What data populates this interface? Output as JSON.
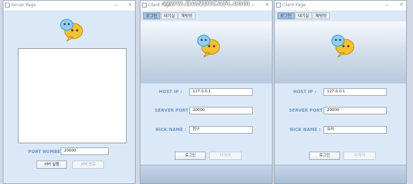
{
  "watermark": "www.BANDICAM.com",
  "server": {
    "title": "Server Page",
    "window_controls": [
      "—",
      "✕"
    ],
    "port_label": "PORT NUMBER :",
    "port_value": "20000",
    "start_button": "서버 실행",
    "stop_button": "서버 종료"
  },
  "client1": {
    "title": "Client Page",
    "window_controls": [
      "—",
      "✕"
    ],
    "tabs": [
      "로그인",
      "대기실",
      "채팅방"
    ],
    "host_label": "HOST IP :",
    "host_value": "127.0.0.1",
    "port_label": "SERVER PORT :",
    "port_value": "20000",
    "nick_label": "NICK NAME :",
    "nick_value": "친구",
    "login_button": "로그인",
    "exit_button": "나가기"
  },
  "client2": {
    "title": "Client Page",
    "window_controls": [
      "—",
      "✕"
    ],
    "tabs": [
      "로그인",
      "대기실",
      "채팅방"
    ],
    "host_label": "HOST IP :",
    "host_value": "127.0.0.1",
    "port_label": "SERVER PORT :",
    "port_value": "20000",
    "nick_label": "NICK NAME :",
    "nick_value": "유리",
    "login_button": "로그인",
    "exit_button": "나가기"
  },
  "icons": {
    "logo": "chat-bubbles-logo-icon",
    "app": "java-app-icon"
  }
}
